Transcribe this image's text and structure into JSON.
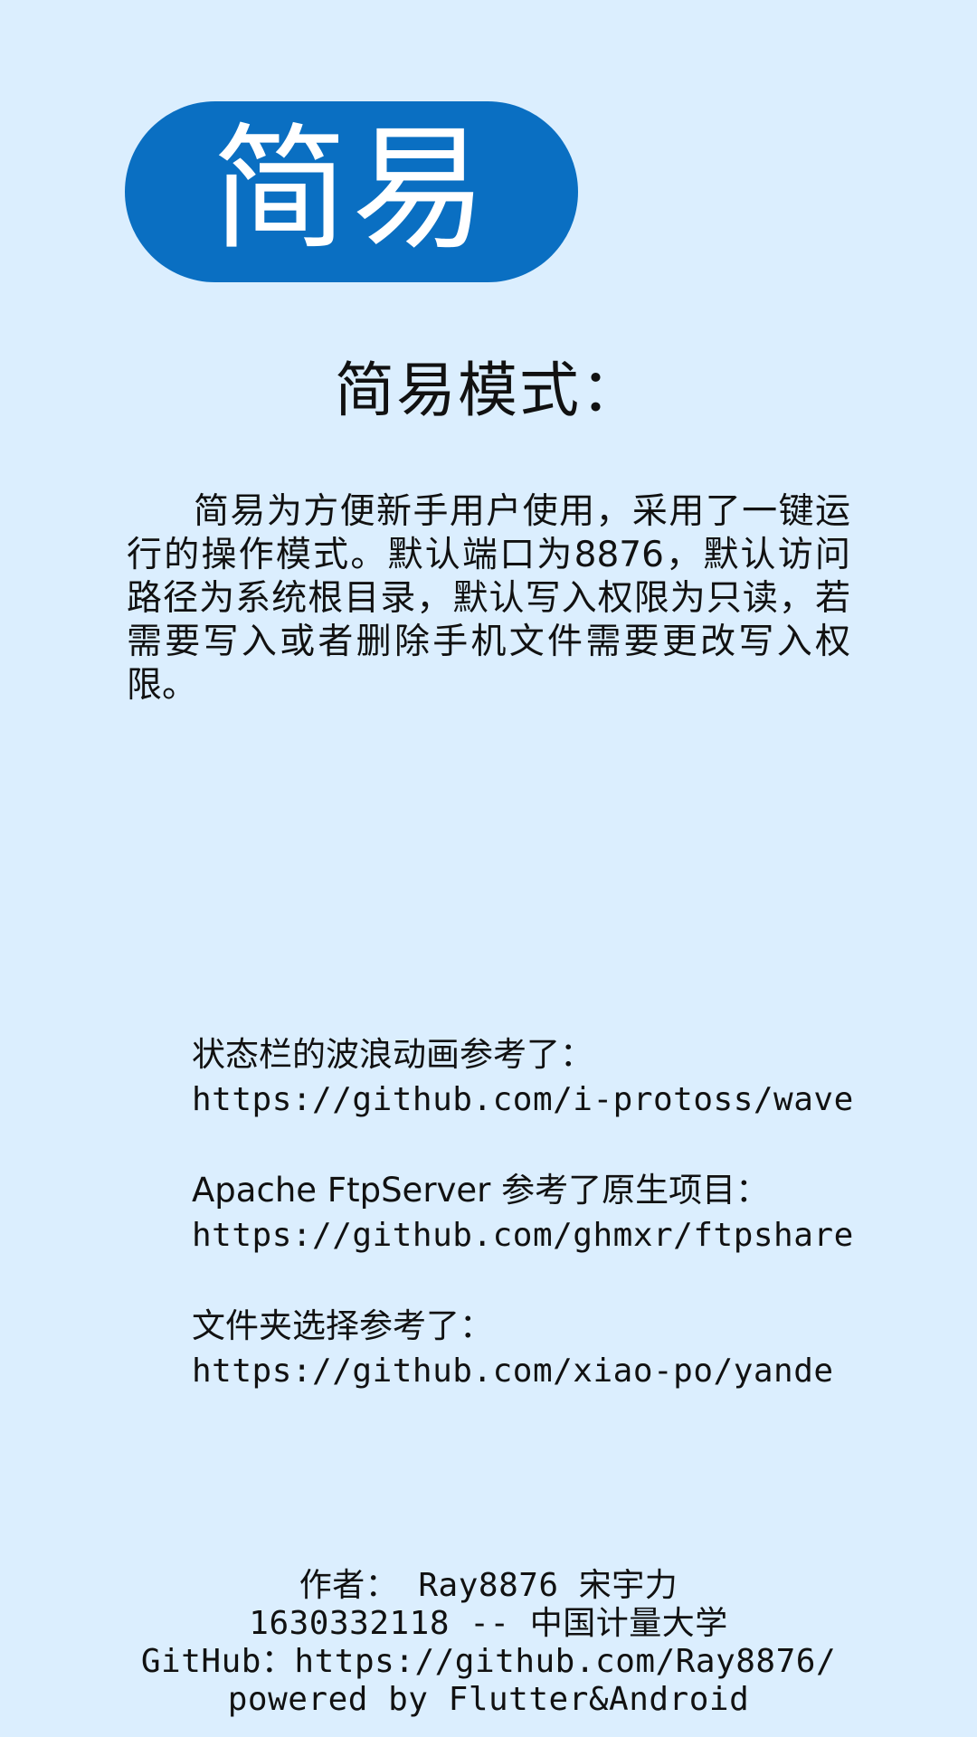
{
  "mode_badge": {
    "label": "简易",
    "bg_color": "#0a6fc2",
    "text_color": "#ffffff"
  },
  "section": {
    "title": "简易模式：",
    "description": "简易为方便新手用户使用，采用了一键运行的操作模式。默认端口为8876，默认访问路径为系统根目录，默认写入权限为只读，若需要写入或者删除手机文件需要更改写入权限。"
  },
  "references": [
    {
      "label": "状态栏的波浪动画参考了：",
      "url": "https://github.com/i-protoss/wave"
    },
    {
      "label": "Apache FtpServer 参考了原生项目：",
      "url": "https://github.com/ghmxr/ftpshare"
    },
    {
      "label": "文件夹选择参考了：",
      "url": "https://github.com/xiao-po/yande"
    }
  ],
  "footer": {
    "author": "作者： Ray8876 宋宇力",
    "student": "1630332118 -- 中国计量大学",
    "github": "GitHub：https://github.com/Ray8876/",
    "powered": "powered by Flutter&Android"
  },
  "colors": {
    "background": "#dbeefe",
    "text": "#111111"
  }
}
